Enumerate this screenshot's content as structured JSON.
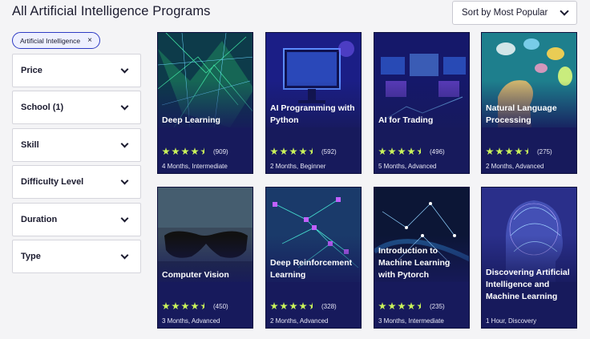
{
  "page": {
    "title": "All Artificial Intelligence Programs"
  },
  "sort": {
    "label": "Sort by Most Popular"
  },
  "active_filter_chip": {
    "label": "Artificial Intelligence"
  },
  "filters": [
    {
      "label": "Price"
    },
    {
      "label": "School (1)"
    },
    {
      "label": "Skill"
    },
    {
      "label": "Difficulty Level"
    },
    {
      "label": "Duration"
    },
    {
      "label": "Type"
    }
  ],
  "colors": {
    "accent": "#2e3bc4",
    "card_bg": "#171a5c",
    "star": "#c9f35a"
  },
  "cards": [
    {
      "title": "Deep Learning",
      "rating": 4.5,
      "reviews": "(909)",
      "meta": "4 Months, Intermediate"
    },
    {
      "title": "AI Programming with Python",
      "rating": 4.5,
      "reviews": "(592)",
      "meta": "2 Months, Beginner"
    },
    {
      "title": "AI for Trading",
      "rating": 4.5,
      "reviews": "(496)",
      "meta": "5 Months, Advanced"
    },
    {
      "title": "Natural Language Processing",
      "rating": 4.5,
      "reviews": "(275)",
      "meta": "2 Months, Advanced"
    },
    {
      "title": "Computer Vision",
      "rating": 4.5,
      "reviews": "(450)",
      "meta": "3 Months, Advanced"
    },
    {
      "title": "Deep Reinforcement Learning",
      "rating": 4.5,
      "reviews": "(328)",
      "meta": "2 Months, Advanced"
    },
    {
      "title": "Introduction to Machine Learning with Pytorch",
      "rating": 4.5,
      "reviews": "(235)",
      "meta": "3 Months, Intermediate"
    },
    {
      "title": "Discovering Artificial Intelligence and Machine Learning",
      "rating": null,
      "reviews": "",
      "meta": "1 Hour, Discovery"
    }
  ]
}
